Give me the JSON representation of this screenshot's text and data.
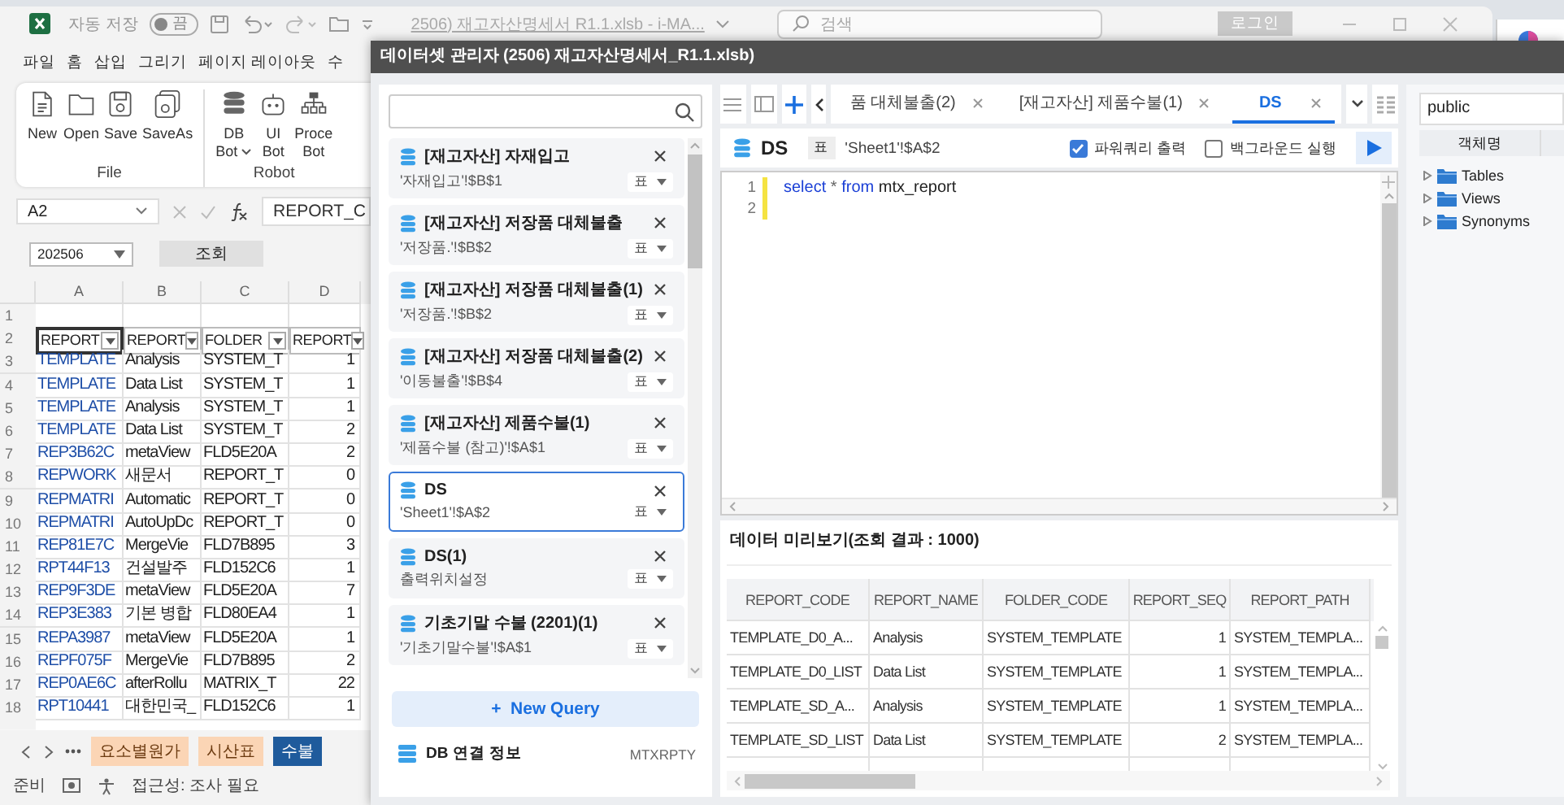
{
  "excel": {
    "title_bar": {
      "autosave_label": "자동 저장",
      "autosave": {
        "on": false,
        "label": "끔"
      },
      "file_name": "2506) 재고자산명세서 R1.1.xlsb - i-MA...",
      "search_placeholder": "검색",
      "login": "로그인"
    },
    "menu": [
      "파일",
      "홈",
      "삽입",
      "그리기",
      "페이지 레이아웃",
      "수"
    ],
    "ribbon": {
      "groups": [
        {
          "label": "File",
          "buttons": [
            {
              "lines": [
                "New"
              ],
              "dropdown": false
            },
            {
              "lines": [
                "Open"
              ],
              "dropdown": false
            },
            {
              "lines": [
                "Save"
              ],
              "dropdown": false
            },
            {
              "lines": [
                "SaveAs"
              ],
              "dropdown": false
            }
          ]
        },
        {
          "label": "Robot",
          "buttons": [
            {
              "lines": [
                "DB",
                "Bot"
              ],
              "dropdown": true
            },
            {
              "lines": [
                "UI",
                "Bot"
              ],
              "dropdown": false
            },
            {
              "lines": [
                "Proce",
                "Bot"
              ],
              "dropdown": false
            }
          ]
        }
      ]
    },
    "formula_bar": {
      "name_box": "A2",
      "formula": "REPORT_C"
    },
    "filter": {
      "period": "202506",
      "button": "조회"
    },
    "grid": {
      "columns": [
        "A",
        "B",
        "C",
        "D"
      ],
      "rows": [
        {
          "number": "1",
          "kind": "empty"
        },
        {
          "number": "2",
          "kind": "header",
          "cells": [
            {
              "text": "REPORT",
              "selected": true
            },
            {
              "text": "REPORT",
              "selected": false
            },
            {
              "text": "FOLDER",
              "selected": false
            },
            {
              "text": "REPORT",
              "selected": false
            }
          ]
        },
        {
          "number": "3",
          "kind": "data",
          "cells": [
            "TEMPLATE",
            "Analysis",
            "SYSTEM_T",
            "1"
          ]
        },
        {
          "number": "4",
          "kind": "data",
          "cells": [
            "TEMPLATE",
            "Data List",
            "SYSTEM_T",
            "1"
          ]
        },
        {
          "number": "5",
          "kind": "data",
          "cells": [
            "TEMPLATE",
            "Analysis",
            "SYSTEM_T",
            "1"
          ]
        },
        {
          "number": "6",
          "kind": "data",
          "cells": [
            "TEMPLATE",
            "Data List",
            "SYSTEM_T",
            "2"
          ]
        },
        {
          "number": "7",
          "kind": "data",
          "cells": [
            "REP3B62C",
            "metaView",
            "FLD5E20A",
            "2"
          ]
        },
        {
          "number": "8",
          "kind": "data",
          "cells": [
            "REPWORK",
            "새문서",
            "REPORT_T",
            "0"
          ]
        },
        {
          "number": "9",
          "kind": "data",
          "cells": [
            "REPMATRI",
            "Automatic",
            "REPORT_T",
            "0"
          ]
        },
        {
          "number": "10",
          "kind": "data",
          "cells": [
            "REPMATRI",
            "AutoUpDc",
            "REPORT_T",
            "0"
          ]
        },
        {
          "number": "11",
          "kind": "data",
          "cells": [
            "REP81E7C",
            "MergeVie",
            "FLD7B895",
            "3"
          ]
        },
        {
          "number": "12",
          "kind": "data",
          "cells": [
            "RPT44F13",
            "건설발주",
            "FLD152C6",
            "1"
          ]
        },
        {
          "number": "13",
          "kind": "data",
          "cells": [
            "REP9F3DE",
            "metaView",
            "FLD5E20A",
            "7"
          ]
        },
        {
          "number": "14",
          "kind": "data",
          "cells": [
            "REP3E383",
            "기본 병합",
            "FLD80EA4",
            "1"
          ]
        },
        {
          "number": "15",
          "kind": "data",
          "cells": [
            "REPA3987",
            "metaView",
            "FLD5E20A",
            "1"
          ]
        },
        {
          "number": "16",
          "kind": "data",
          "cells": [
            "REPF075F",
            "MergeVie",
            "FLD7B895",
            "2"
          ]
        },
        {
          "number": "17",
          "kind": "data",
          "cells": [
            "REP0AE6C",
            "afterRollu",
            "MATRIX_T",
            "22"
          ]
        },
        {
          "number": "18",
          "kind": "data",
          "cells": [
            "RPT10441",
            "대한민국_",
            "FLD152C6",
            "1"
          ]
        }
      ]
    },
    "sheet_tabs": [
      {
        "label": "요소별원가",
        "selected": false
      },
      {
        "label": "시산표",
        "selected": false
      },
      {
        "label": "수불",
        "selected": true
      }
    ],
    "status_bar": {
      "ready": "준비",
      "accessibility": "접근성: 조사 필요"
    }
  },
  "dialog": {
    "title": "데이터셋 관리자 (2506) 재고자산명세서_R1.1.xlsb)",
    "queries": [
      {
        "title": "[재고자산] 자재입고",
        "location": "'자재입고'!$B$1",
        "output": "표",
        "selected": false
      },
      {
        "title": "[재고자산] 저장품 대체불출",
        "location": "'저장품.'!$B$2",
        "output": "표",
        "selected": false
      },
      {
        "title": "[재고자산] 저장품 대체불출(1)",
        "location": "'저장품.'!$B$2",
        "output": "표",
        "selected": false
      },
      {
        "title": "[재고자산] 저장품 대체불출(2)",
        "location": "'이동불출'!$B$4",
        "output": "표",
        "selected": false
      },
      {
        "title": "[재고자산] 제품수불(1)",
        "location": "'제품수불 (참고)'!$A$1",
        "output": "표",
        "selected": false
      },
      {
        "title": "DS",
        "location": "'Sheet1'!$A$2",
        "output": "표",
        "selected": true
      },
      {
        "title": "DS(1)",
        "location": "출력위치설정",
        "output": "표",
        "selected": false
      },
      {
        "title": "기초기말 수불 (2201)(1)",
        "location": "'기초기말수불'!$A$1",
        "output": "표",
        "selected": false
      }
    ],
    "new_query": {
      "icon": "+",
      "label": "New Query"
    },
    "db_connection": {
      "label": "DB 연결 정보",
      "schema": "MTXRPTY"
    },
    "tabs": [
      {
        "label": "품 대체불출(2)",
        "selected": false
      },
      {
        "label": "[재고자산] 제품수불(1)",
        "selected": false
      },
      {
        "label": "DS",
        "selected": true
      }
    ],
    "editor": {
      "name": "DS",
      "output": "표",
      "location": "'Sheet1'!$A$2",
      "options": [
        {
          "label": "파워쿼리 출력",
          "checked": true
        },
        {
          "label": "백그라운드 실행",
          "checked": false
        }
      ],
      "lines": [
        {
          "number": "1",
          "modified": true,
          "tokens": [
            {
              "kind": "keyword",
              "text": "select"
            },
            {
              "kind": "operator",
              "text": "*"
            },
            {
              "kind": "keyword",
              "text": "from"
            },
            {
              "kind": "identifier",
              "text": "mtx_report"
            }
          ]
        },
        {
          "number": "2",
          "modified": true
        }
      ]
    },
    "preview": {
      "title": "데이터 미리보기(조회 결과 : 1000)",
      "columns": [
        "REPORT_CODE",
        "REPORT_NAME",
        "FOLDER_CODE",
        "REPORT_SEQ",
        "REPORT_PATH"
      ],
      "rows": [
        [
          "TEMPLATE_D0_A...",
          "Analysis",
          "SYSTEM_TEMPLATE",
          "1",
          "SYSTEM_TEMPLA..."
        ],
        [
          "TEMPLATE_D0_LIST",
          "Data List",
          "SYSTEM_TEMPLATE",
          "1",
          "SYSTEM_TEMPLA..."
        ],
        [
          "TEMPLATE_SD_A...",
          "Analysis",
          "SYSTEM_TEMPLATE",
          "1",
          "SYSTEM_TEMPLA..."
        ],
        [
          "TEMPLATE_SD_LIST",
          "Data List",
          "SYSTEM_TEMPLATE",
          "2",
          "SYSTEM_TEMPLA..."
        ]
      ]
    },
    "object_browser": {
      "schema": "public",
      "header": "객체명",
      "items": [
        {
          "label": "Tables",
          "expanded": false
        },
        {
          "label": "Views",
          "expanded": false
        },
        {
          "label": "Synonyms",
          "expanded": false
        }
      ]
    }
  }
}
